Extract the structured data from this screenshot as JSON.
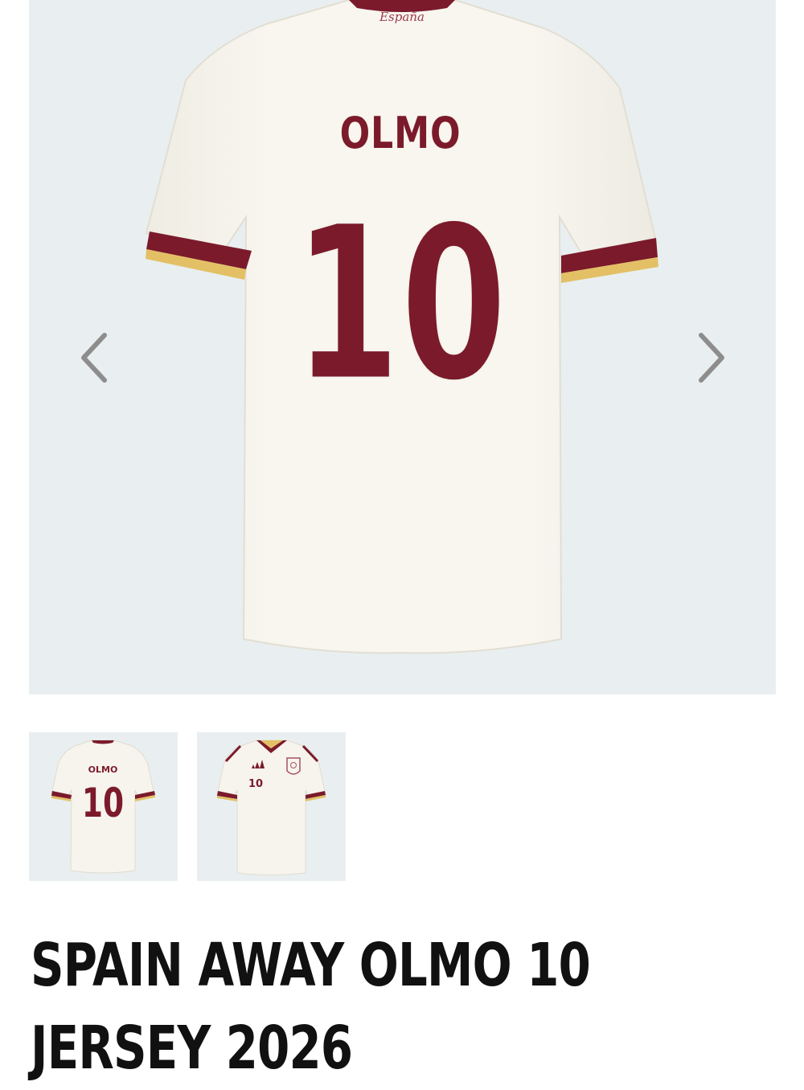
{
  "product": {
    "brand_script": "España",
    "player_name": "OLMO",
    "player_number": "10",
    "title": "SPAIN AWAY OLMO 10 JERSEY 2026"
  },
  "gallery": {
    "icons": {
      "prev": "chevron-left-icon",
      "next": "chevron-right-icon"
    },
    "thumbnails": [
      {
        "view": "back",
        "name_text": "OLMO",
        "number_text": "10"
      },
      {
        "view": "front",
        "number_text": "10"
      }
    ]
  },
  "colors": {
    "background": "#e9eff0",
    "jersey": "#f6f4ec",
    "maroon": "#7b1a2b",
    "gold": "#e3c065",
    "arrow": "#8d8d8d",
    "title": "#111111"
  }
}
